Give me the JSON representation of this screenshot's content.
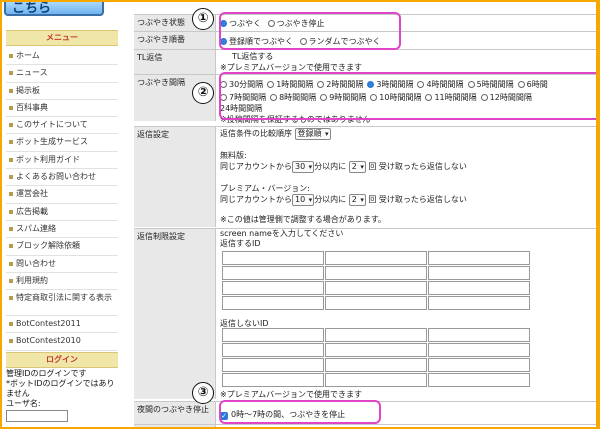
{
  "sidebar": {
    "logo": "こちら",
    "menu_title": "メニュー",
    "items": [
      {
        "label": "ホーム"
      },
      {
        "label": "ニュース"
      },
      {
        "label": "掲示板"
      },
      {
        "label": "百科事典"
      },
      {
        "label": "このサイトについて"
      },
      {
        "label": "ボット生成サービス"
      },
      {
        "label": "ボット利用ガイド"
      },
      {
        "label": "よくあるお問い合わせ"
      },
      {
        "label": "運営会社"
      },
      {
        "label": "広告掲載"
      },
      {
        "label": "スパム連絡"
      },
      {
        "label": "ブロック解除依頼"
      },
      {
        "label": "問い合わせ"
      },
      {
        "label": "利用規約"
      },
      {
        "label": "特定商取引法に関する表示"
      },
      {
        "label": "BotContest2011"
      },
      {
        "label": "BotContest2010"
      }
    ],
    "login_title": "ログイン",
    "login_line1": "管理IDのログインです",
    "login_line2": "*ボットIDのログインではありません",
    "username_label": "ユーザ名:"
  },
  "tweet_status": {
    "label": "つぶやき状態",
    "opt1": "つぶやく",
    "opt2": "つぶやき停止"
  },
  "tweet_order": {
    "label": "つぶやき順番",
    "opt1": "登録順でつぶやく",
    "opt2": "ランダムでつぶやく"
  },
  "tl_reply": {
    "label": "TL返信",
    "opt": "TL返信する",
    "note": "※プレミアムバージョンで使用できます"
  },
  "tweet_interval": {
    "label": "つぶやき間隔",
    "row1": [
      "30分間隔",
      "1時間間隔",
      "2時間間隔",
      "3時間間隔",
      "4時間間隔",
      "5時間間隔",
      "6時間"
    ],
    "row2": [
      "7時間間隔",
      "8時間間隔",
      "9時間間隔",
      "10時間間隔",
      "11時間間隔",
      "12時間間隔"
    ],
    "last": "24時間間隔",
    "note": "※投稿間隔を保証するものではありません"
  },
  "reply_settings": {
    "label": "返信設定",
    "order_label": "返信条件の比較順序",
    "order_value": "登録順",
    "free_label": "無料版:",
    "free_pre": "同じアカウントから",
    "free_minutes": "30",
    "free_mid": "分以内に",
    "free_count": "2",
    "free_post": "回 受け取ったら返信しない",
    "premium_label": "プレミアム・バージョン:",
    "prem_pre": "同じアカウントから",
    "prem_minutes": "10",
    "prem_mid": "分以内に",
    "prem_count": "2",
    "prem_post": "回 受け取ったら返信しない",
    "admin_note": "※この値は管理側で調整する場合があります。"
  },
  "reply_limit": {
    "label": "返信制限設定",
    "instr": "screen nameを入力してください",
    "reply_id": "返信するID",
    "noreply_id": "返信しないID",
    "note": "※プレミアムバージョンで使用できます"
  },
  "night": {
    "label": "夜間のつぶやき停止",
    "opt": "0時〜7時の間、つぶやきを停止"
  },
  "annotations": {
    "c1": "①",
    "c2": "②",
    "c3": "③"
  },
  "colors": {
    "highlight": "#e044c8",
    "border": "#f6a800",
    "radio": "#2979d6"
  }
}
